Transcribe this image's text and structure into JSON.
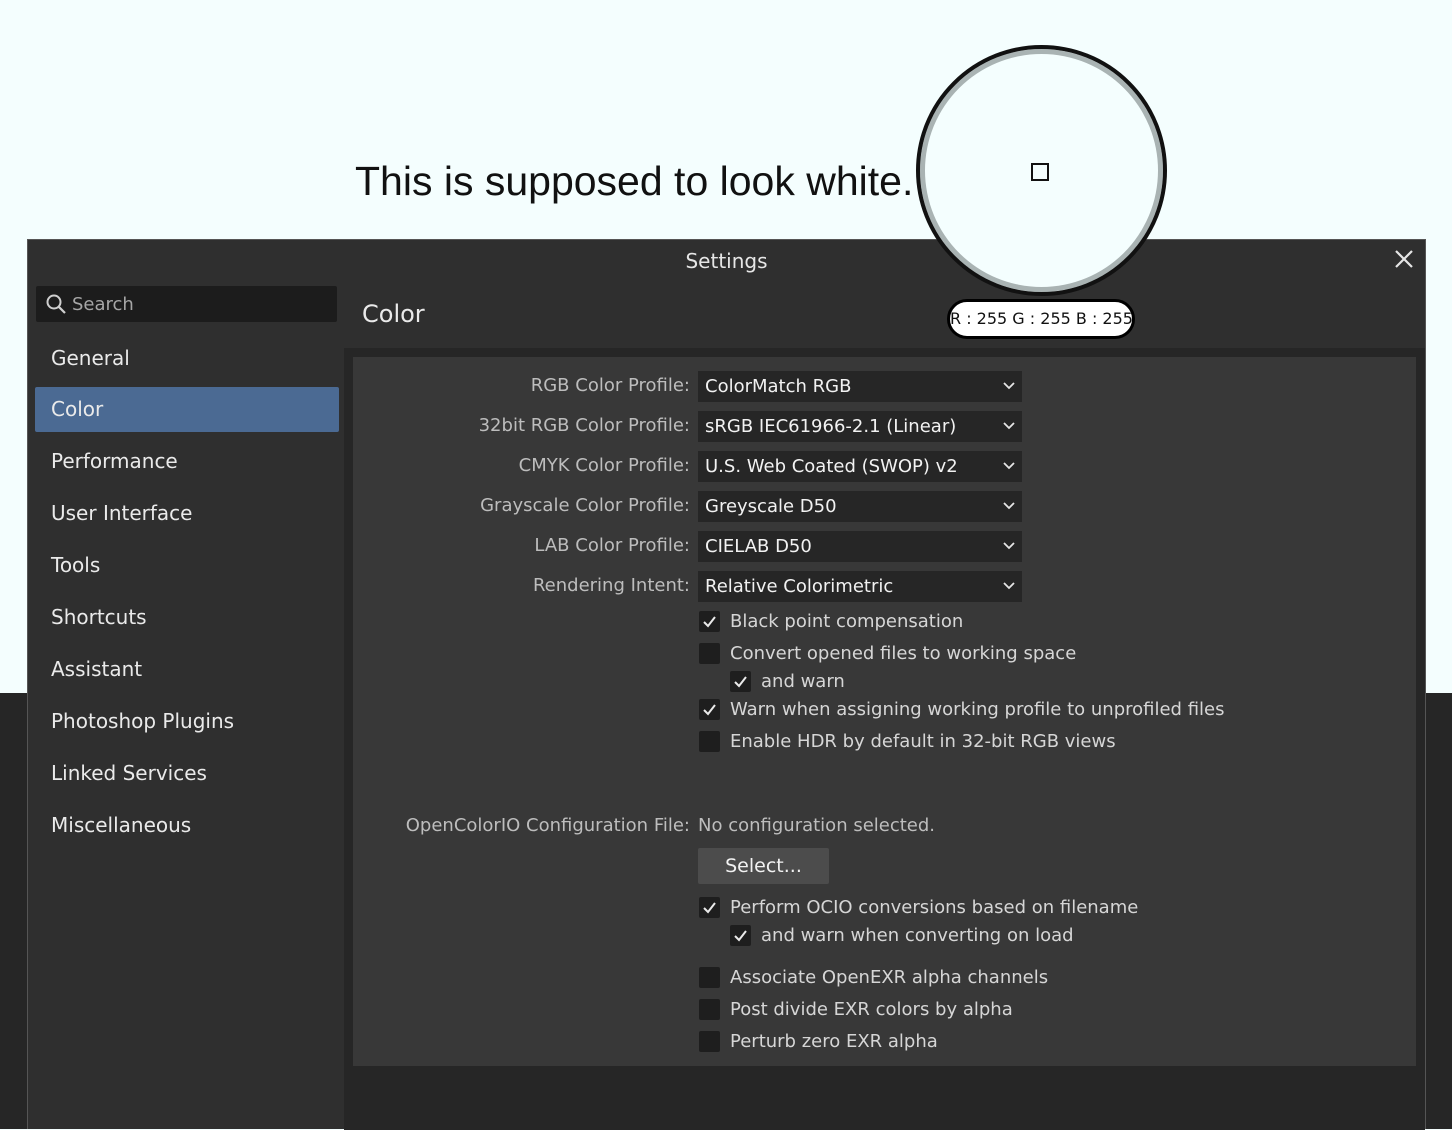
{
  "headline": "This is supposed to look white.",
  "window": {
    "title": "Settings"
  },
  "search": {
    "placeholder": "Search"
  },
  "sidebar": {
    "items": [
      {
        "label": "General"
      },
      {
        "label": "Color"
      },
      {
        "label": "Performance"
      },
      {
        "label": "User Interface"
      },
      {
        "label": "Tools"
      },
      {
        "label": "Shortcuts"
      },
      {
        "label": "Assistant"
      },
      {
        "label": "Photoshop Plugins"
      },
      {
        "label": "Linked Services"
      },
      {
        "label": "Miscellaneous"
      }
    ],
    "active": "Color"
  },
  "panel": {
    "title": "Color",
    "profiles": [
      {
        "label": "RGB Color Profile:",
        "value": "ColorMatch RGB"
      },
      {
        "label": "32bit RGB Color Profile:",
        "value": "sRGB IEC61966-2.1 (Linear)"
      },
      {
        "label": "CMYK Color Profile:",
        "value": "U.S. Web Coated (SWOP) v2"
      },
      {
        "label": "Grayscale Color Profile:",
        "value": "Greyscale D50"
      },
      {
        "label": "LAB Color Profile:",
        "value": "CIELAB D50"
      },
      {
        "label": "Rendering Intent:",
        "value": "Relative Colorimetric"
      }
    ],
    "options": [
      {
        "label": "Black point compensation",
        "checked": true
      },
      {
        "label": "Convert opened files to working space",
        "checked": false
      },
      {
        "label": "and warn",
        "checked": true
      },
      {
        "label": "Warn when assigning working profile to unprofiled files",
        "checked": true
      },
      {
        "label": "Enable HDR by default in 32-bit RGB views",
        "checked": false
      }
    ],
    "ocio": {
      "label": "OpenColorIO Configuration File:",
      "value": "No configuration selected.",
      "button": "Select..."
    },
    "ocio_options": [
      {
        "label": "Perform OCIO conversions based on filename",
        "checked": true
      },
      {
        "label": "and warn when converting on load",
        "checked": true
      },
      {
        "label": "Associate OpenEXR alpha channels",
        "checked": false
      },
      {
        "label": "Post divide EXR colors by alpha",
        "checked": false
      },
      {
        "label": "Perturb zero EXR alpha",
        "checked": false
      }
    ]
  },
  "picker": {
    "readout": "R : 255 G : 255 B : 255"
  },
  "colors": {
    "accent": "#4b6a93",
    "panel": "#383838",
    "background": "#f4fefe"
  }
}
